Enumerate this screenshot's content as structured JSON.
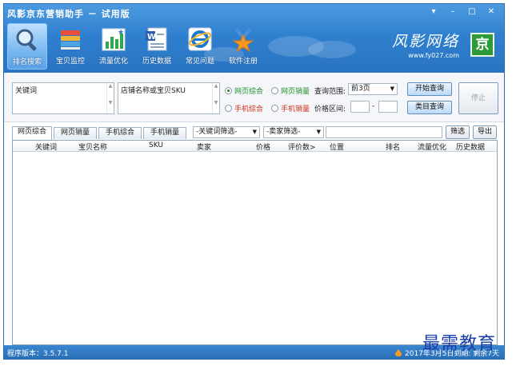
{
  "window": {
    "title": "风影京东营销助手 － 试用版",
    "controls": [
      "▾",
      "–",
      "□",
      "✕"
    ]
  },
  "toolbar": [
    {
      "label": "排名搜索",
      "icon": "magnifier-icon",
      "active": true
    },
    {
      "label": "宝贝监控",
      "icon": "books-icon",
      "active": false
    },
    {
      "label": "流量优化",
      "icon": "bar-chart-icon",
      "active": false
    },
    {
      "label": "历史数据",
      "icon": "word-document-icon",
      "active": false
    },
    {
      "label": "常见问题",
      "icon": "ie-browser-icon",
      "active": false
    },
    {
      "label": "软件注册",
      "icon": "star-medal-icon",
      "active": false
    }
  ],
  "brand": {
    "name": "风影网络",
    "url": "www.fy027.com",
    "logo_text": "京"
  },
  "query": {
    "keyword_value": "关键词",
    "shop_value": "店铺名称或宝贝SKU",
    "radios": [
      {
        "label": "网页综合",
        "checked": true,
        "color": "green"
      },
      {
        "label": "网页销量",
        "checked": false,
        "color": "green"
      },
      {
        "label": "手机综合",
        "checked": false,
        "color": "red"
      },
      {
        "label": "手机销量",
        "checked": false,
        "color": "red"
      }
    ],
    "range_label": "查询范围:",
    "range_value": "前3页",
    "price_label": "价格区间:",
    "price_sep": "-",
    "start_button": "开始查询",
    "category_button": "类目查询",
    "stop_button": "停止"
  },
  "tabs": [
    "网页综合",
    "网页销量",
    "手机综合",
    "手机销量"
  ],
  "filters": {
    "keyword_filter": "-关键词筛选-",
    "seller_filter": "-卖家筛选-",
    "filter_button": "筛选",
    "export_button": "导出"
  },
  "table": {
    "columns": [
      "关键词",
      "宝贝名称",
      "SKU",
      "卖家",
      "价格",
      "评价数>",
      "位置",
      "排名",
      "流量优化",
      "历史数据"
    ],
    "rows": []
  },
  "status": {
    "version": "程序版本：3.5.7.1",
    "expire": "2017年3月5日到期: 剩余7天"
  },
  "watermark": "最需教育",
  "colors": {
    "header": "#2f80cf",
    "green": "#1f8f2a",
    "red": "#d0301c",
    "status_bar": "#2a6fb5"
  }
}
